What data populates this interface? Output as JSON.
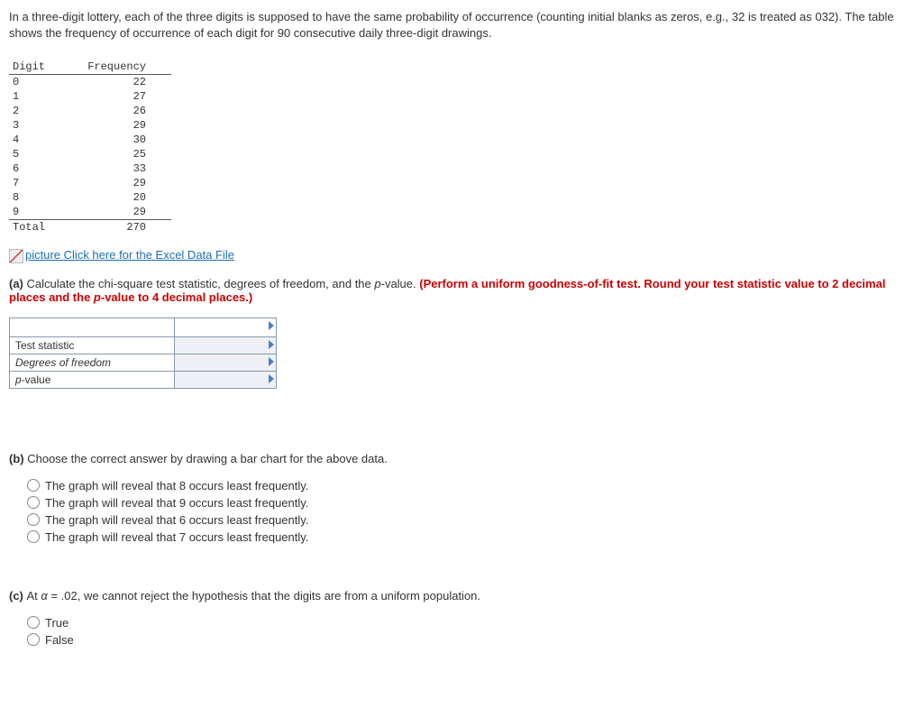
{
  "intro": "In a three-digit lottery, each of the three digits is supposed to have the same probability of occurrence (counting initial blanks as zeros, e.g., 32 is treated as 032). The table shows the frequency of occurrence of each digit for 90 consecutive daily three-digit drawings.",
  "freq": {
    "h1": "Digit",
    "h2": "Frequency",
    "rows": [
      {
        "d": "0",
        "f": "22"
      },
      {
        "d": "1",
        "f": "27"
      },
      {
        "d": "2",
        "f": "26"
      },
      {
        "d": "3",
        "f": "29"
      },
      {
        "d": "4",
        "f": "30"
      },
      {
        "d": "5",
        "f": "25"
      },
      {
        "d": "6",
        "f": "33"
      },
      {
        "d": "7",
        "f": "29"
      },
      {
        "d": "8",
        "f": "20"
      },
      {
        "d": "9",
        "f": "29"
      }
    ],
    "total_label": "Total",
    "total_val": "270"
  },
  "excel": {
    "alt": "picture",
    "text": "Click here for the Excel Data File"
  },
  "partA": {
    "label": "(a) ",
    "text1": "Calculate the chi-square test statistic, degrees of freedom, and the ",
    "pval": "p",
    "text2": "-value. ",
    "red1": "(Perform a uniform goodness-of-fit test. Round your test statistic value to 2 decimal places and the ",
    "redp": "p",
    "red2": "-value to 4 decimal places.)",
    "rows": {
      "r1": "Test statistic",
      "r2": "Degrees of freedom",
      "r3p": "p",
      "r3": "-value"
    }
  },
  "partB": {
    "label": "(b) ",
    "text": "Choose the correct answer by drawing a bar chart for the above data.",
    "opts": [
      "The graph will reveal that 8 occurs least frequently.",
      "The graph will reveal that 9 occurs least frequently.",
      "The graph will reveal that 6 occurs least frequently.",
      "The graph will reveal that 7 occurs least frequently."
    ]
  },
  "partC": {
    "label": "(c) ",
    "text1": "At ",
    "alpha": "α",
    "text2": " = .02, we cannot reject the hypothesis that the digits are from a uniform population.",
    "true": "True",
    "false": "False"
  }
}
